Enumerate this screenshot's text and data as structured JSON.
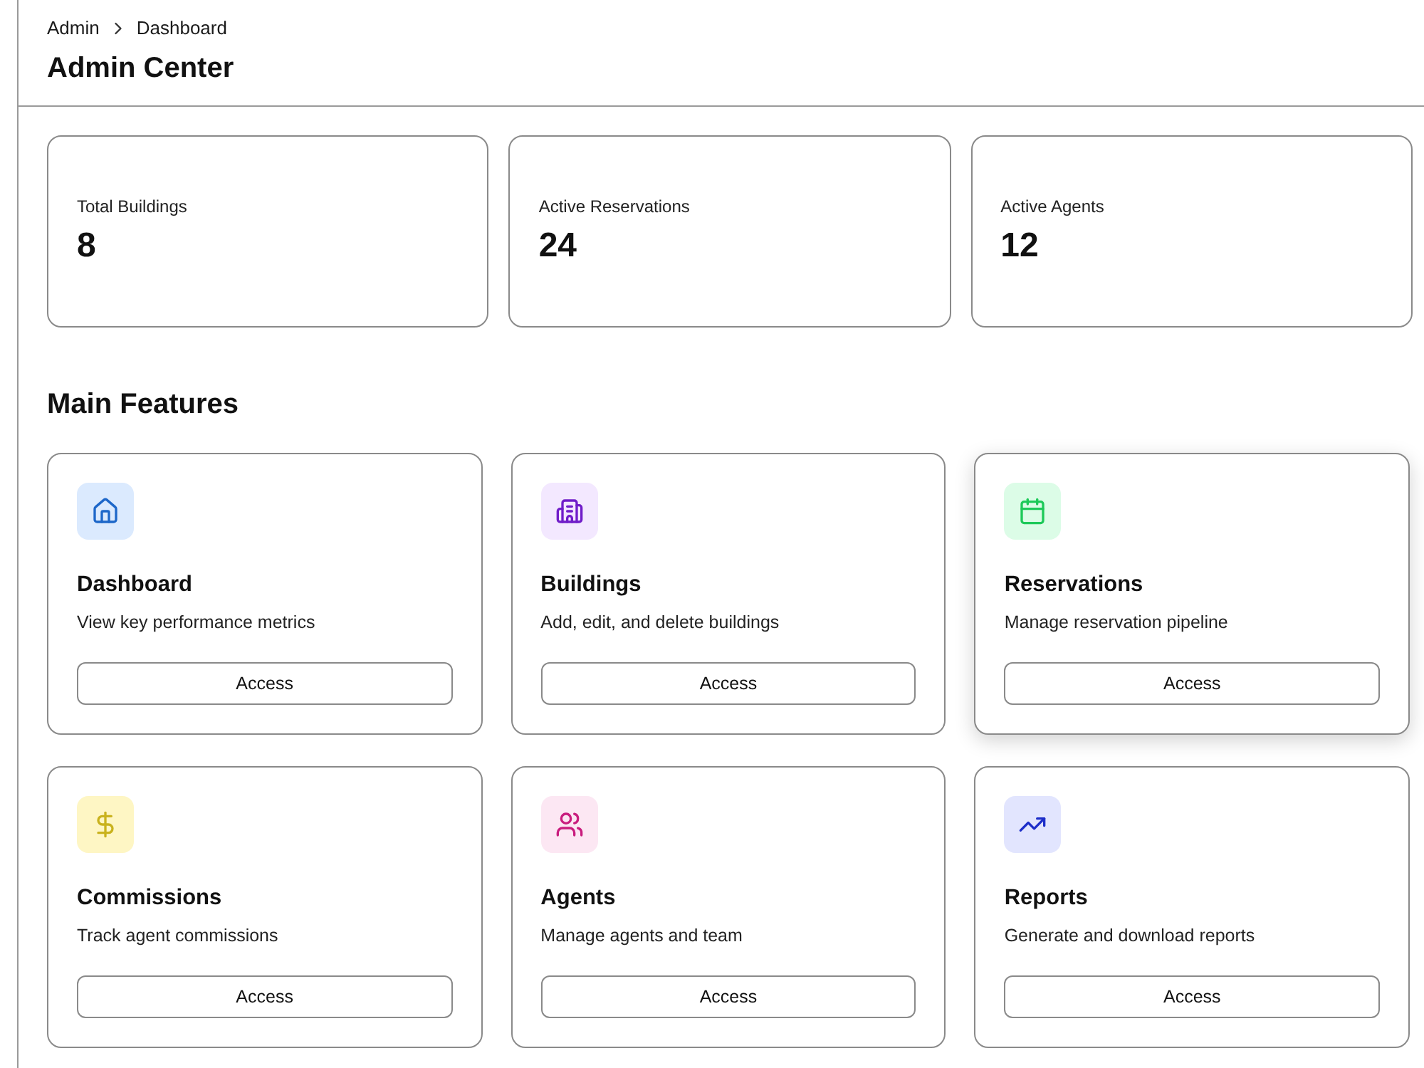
{
  "breadcrumb": [
    "Admin",
    "Dashboard"
  ],
  "page_title": "Admin Center",
  "stats": [
    {
      "label": "Total Buildings",
      "value": "8"
    },
    {
      "label": "Active Reservations",
      "value": "24"
    },
    {
      "label": "Active Agents",
      "value": "12"
    }
  ],
  "section_title": "Main Features",
  "features": [
    {
      "title": "Dashboard",
      "description": "View key performance metrics",
      "button": "Access",
      "color": "#dbeafe",
      "hovered": false
    },
    {
      "title": "Buildings",
      "description": "Add, edit, and delete buildings",
      "button": "Access",
      "color": "#f3e8ff",
      "hovered": false
    },
    {
      "title": "Reservations",
      "description": "Manage reservation pipeline",
      "button": "Access",
      "color": "#dcfce7",
      "hovered": true
    },
    {
      "title": "Commissions",
      "description": "Track agent commissions",
      "button": "Access",
      "color": "#fef6c4",
      "hovered": false
    },
    {
      "title": "Agents",
      "description": "Manage agents and team",
      "button": "Access",
      "color": "#fce7f3",
      "hovered": false
    },
    {
      "title": "Reports",
      "description": "Generate and download reports",
      "button": "Access",
      "color": "#e2e5fe",
      "hovered": false
    }
  ]
}
